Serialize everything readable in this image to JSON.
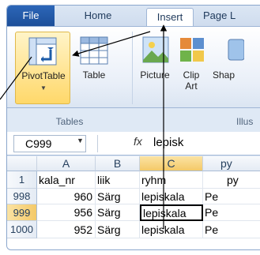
{
  "tabs": {
    "file": "File",
    "home": "Home",
    "insert": "Insert",
    "page": "Page L"
  },
  "ribbon": {
    "pivottable": "PivotTable",
    "table": "Table",
    "picture": "Picture",
    "clipart_1": "Clip",
    "clipart_2": "Art",
    "shapes": "Shap",
    "group_tables": "Tables",
    "group_illus": "Illus"
  },
  "formula_bar": {
    "name_box": "C999",
    "fx": "fx",
    "content": "lepisk"
  },
  "columns": [
    "A",
    "B",
    "C",
    "py"
  ],
  "rows": [
    {
      "num": "1",
      "a": "kala_nr",
      "b": "liik",
      "c": "ryhm",
      "d": "py"
    },
    {
      "num": "998",
      "a": "960",
      "b": "Särg",
      "c": "lepiskala",
      "d": "Pe"
    },
    {
      "num": "999",
      "a": "956",
      "b": "Särg",
      "c": "lepiskala",
      "d": "Pe"
    },
    {
      "num": "1000",
      "a": "952",
      "b": "Särg",
      "c": "lepiskala",
      "d": "Pe"
    }
  ],
  "colors": {
    "accent": "#1d4f99",
    "selected_row": "#f9d77e",
    "annotation": "#000000"
  }
}
